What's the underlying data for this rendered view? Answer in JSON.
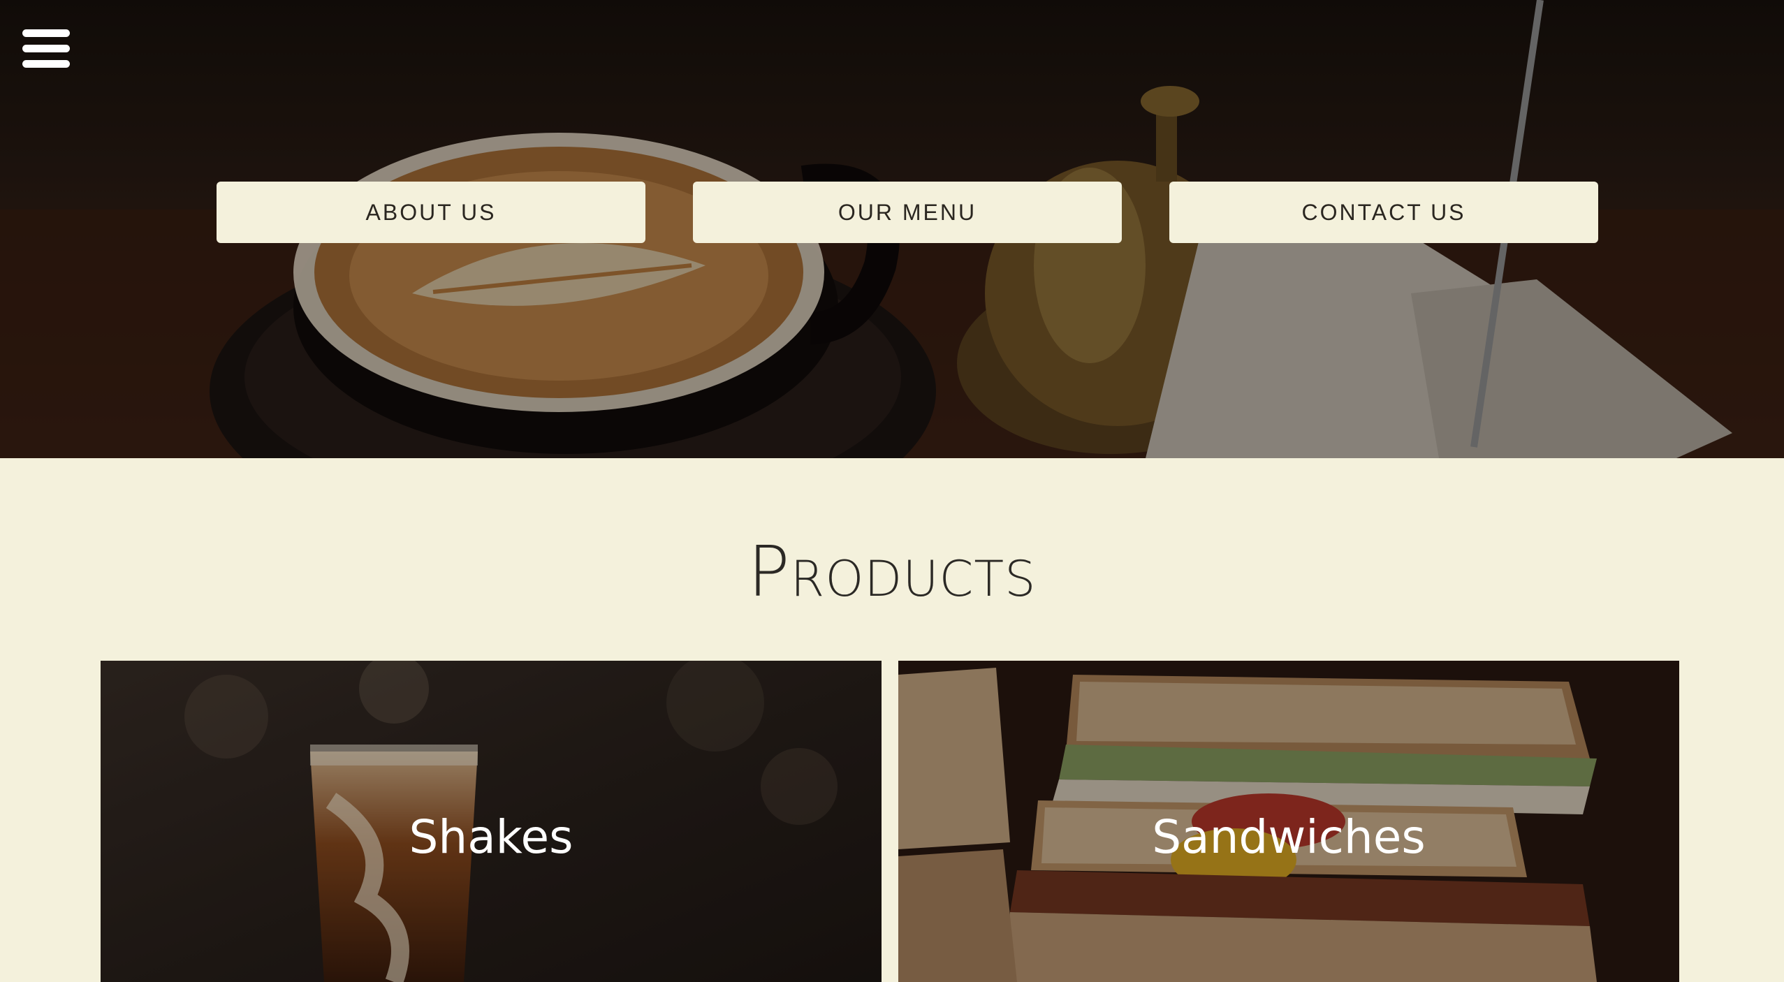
{
  "nav": {
    "menu_icon": "hamburger-menu-icon",
    "buttons": [
      {
        "label": "ABOUT US"
      },
      {
        "label": "OUR MENU"
      },
      {
        "label": "CONTACT US"
      }
    ]
  },
  "products": {
    "title": "Products",
    "items": [
      {
        "label": "Shakes"
      },
      {
        "label": "Sandwiches"
      }
    ]
  },
  "colors": {
    "background": "#f4f1dc",
    "button_bg": "#f4f1dc",
    "button_text": "#2a2620",
    "title_text": "#2b2925",
    "card_text": "#ffffff"
  }
}
